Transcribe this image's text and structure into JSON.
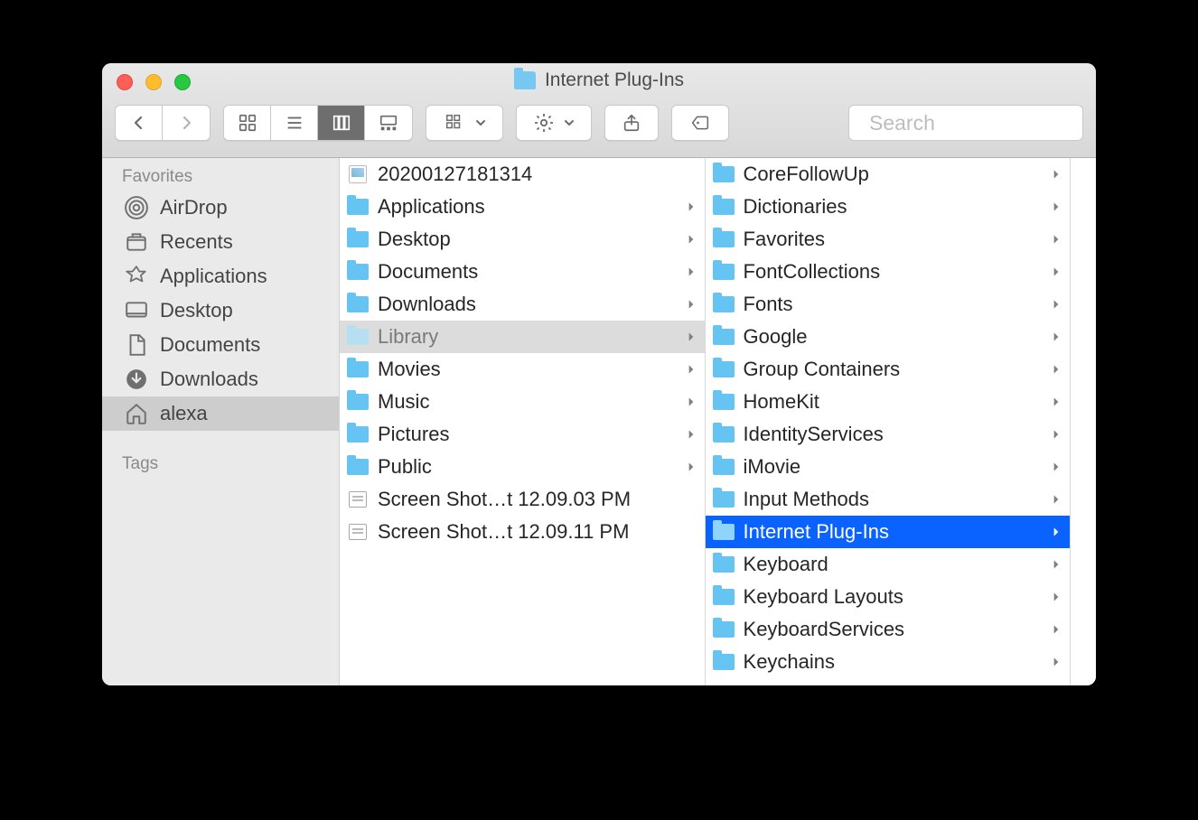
{
  "window": {
    "title": "Internet Plug-Ins"
  },
  "toolbar": {
    "search_placeholder": "Search"
  },
  "sidebar": {
    "favorites_label": "Favorites",
    "tags_label": "Tags",
    "items": [
      {
        "label": "AirDrop",
        "icon": "airdrop"
      },
      {
        "label": "Recents",
        "icon": "recents"
      },
      {
        "label": "Applications",
        "icon": "applications"
      },
      {
        "label": "Desktop",
        "icon": "desktop"
      },
      {
        "label": "Documents",
        "icon": "documents"
      },
      {
        "label": "Downloads",
        "icon": "downloads"
      },
      {
        "label": "alexa",
        "icon": "home",
        "selected": true
      }
    ]
  },
  "columns": {
    "col1": [
      {
        "label": "20200127181314",
        "type": "file-img"
      },
      {
        "label": "Applications",
        "type": "folder",
        "arrow": true
      },
      {
        "label": "Desktop",
        "type": "folder",
        "arrow": true
      },
      {
        "label": "Documents",
        "type": "folder",
        "arrow": true
      },
      {
        "label": "Downloads",
        "type": "folder",
        "arrow": true
      },
      {
        "label": "Library",
        "type": "folder",
        "arrow": true,
        "sel": "gray"
      },
      {
        "label": "Movies",
        "type": "folder",
        "arrow": true
      },
      {
        "label": "Music",
        "type": "folder",
        "arrow": true
      },
      {
        "label": "Pictures",
        "type": "folder",
        "arrow": true
      },
      {
        "label": "Public",
        "type": "folder",
        "arrow": true
      },
      {
        "label": "Screen Shot…t 12.09.03 PM",
        "type": "file"
      },
      {
        "label": "Screen Shot…t 12.09.11 PM",
        "type": "file"
      }
    ],
    "col2": [
      {
        "label": "CoreFollowUp",
        "type": "folder",
        "arrow": true
      },
      {
        "label": "Dictionaries",
        "type": "folder",
        "arrow": true
      },
      {
        "label": "Favorites",
        "type": "folder",
        "arrow": true
      },
      {
        "label": "FontCollections",
        "type": "folder",
        "arrow": true
      },
      {
        "label": "Fonts",
        "type": "folder",
        "arrow": true
      },
      {
        "label": "Google",
        "type": "folder",
        "arrow": true
      },
      {
        "label": "Group Containers",
        "type": "folder",
        "arrow": true
      },
      {
        "label": "HomeKit",
        "type": "folder",
        "arrow": true
      },
      {
        "label": "IdentityServices",
        "type": "folder",
        "arrow": true
      },
      {
        "label": "iMovie",
        "type": "folder",
        "arrow": true
      },
      {
        "label": "Input Methods",
        "type": "folder",
        "arrow": true
      },
      {
        "label": "Internet Plug-Ins",
        "type": "folder",
        "arrow": true,
        "sel": "blue"
      },
      {
        "label": "Keyboard",
        "type": "folder",
        "arrow": true
      },
      {
        "label": "Keyboard Layouts",
        "type": "folder",
        "arrow": true
      },
      {
        "label": "KeyboardServices",
        "type": "folder",
        "arrow": true
      },
      {
        "label": "Keychains",
        "type": "folder",
        "arrow": true
      }
    ]
  }
}
